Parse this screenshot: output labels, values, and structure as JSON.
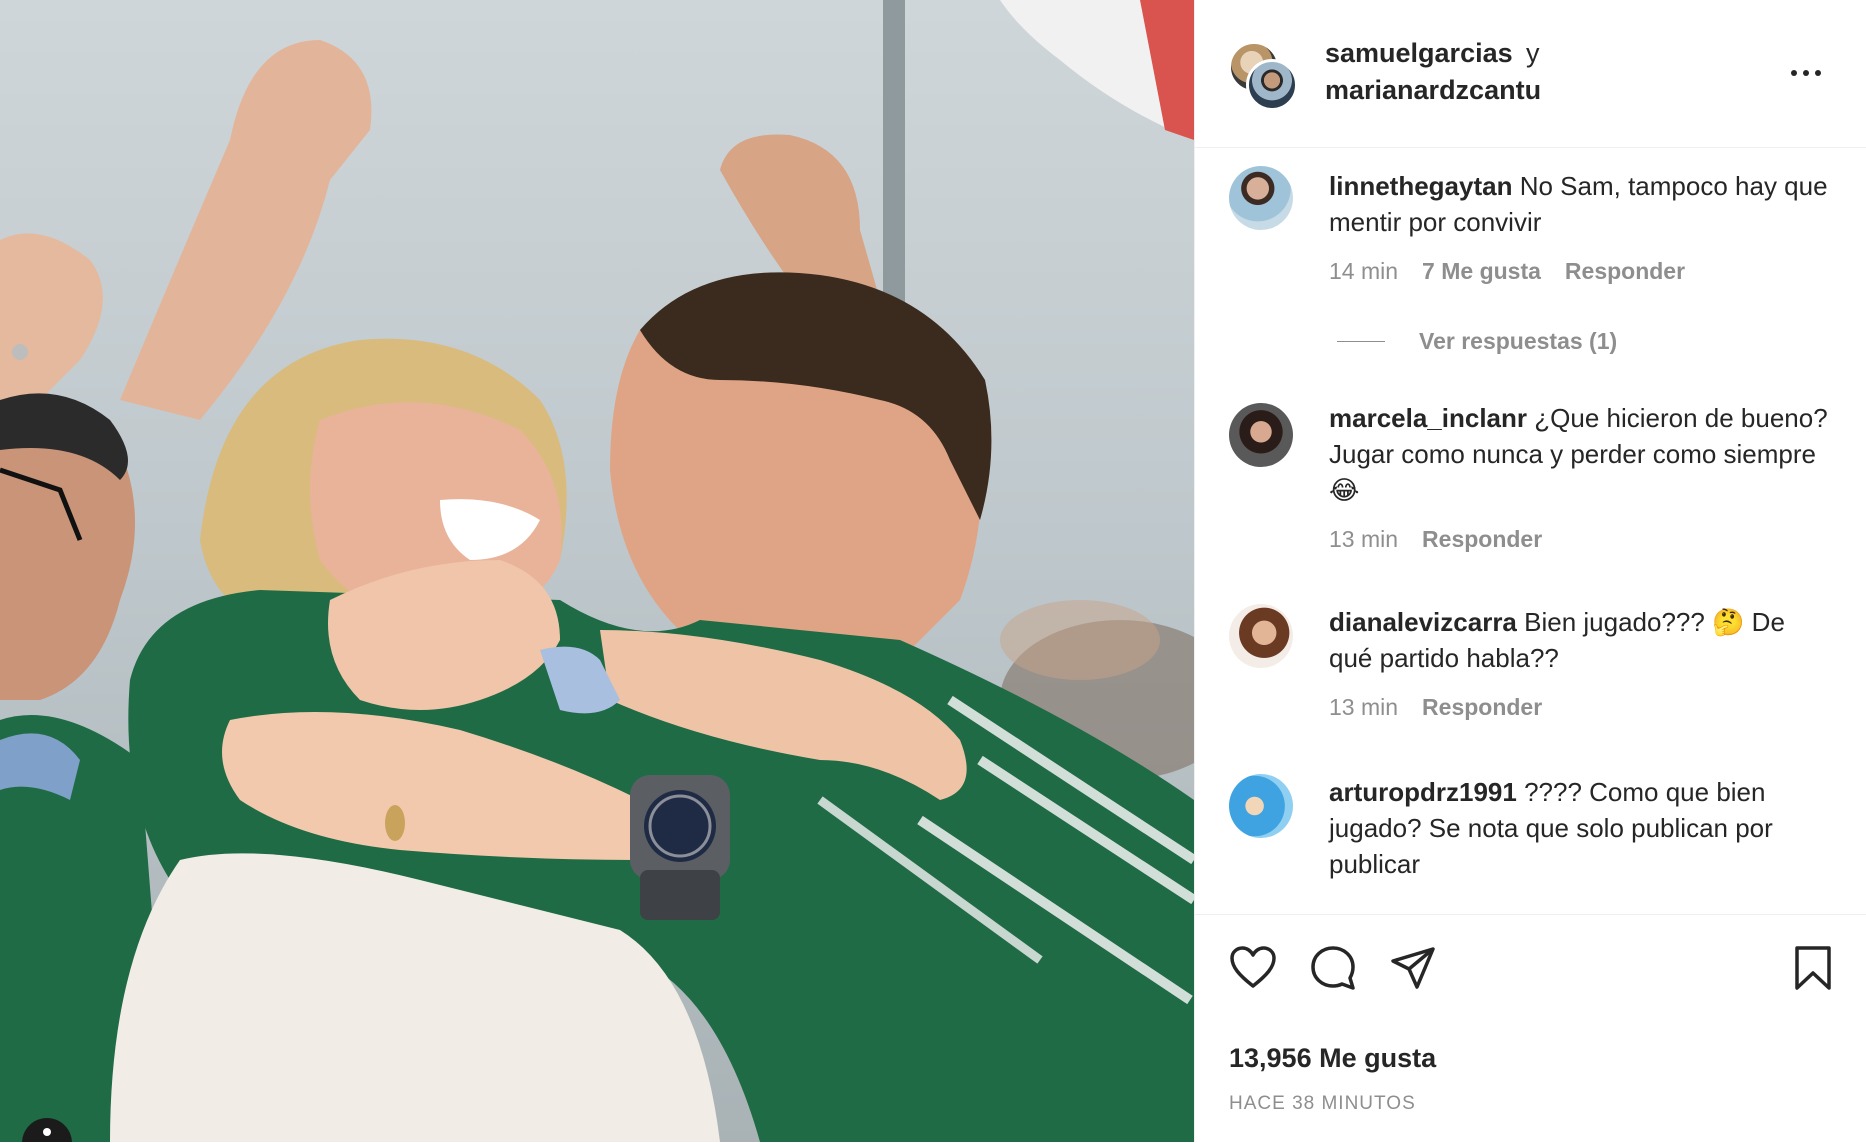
{
  "post": {
    "authors": {
      "first": "samuelgarcias",
      "connector": "y",
      "second": "marianardzcantu"
    },
    "more_icon": "more-options-icon",
    "likes": "13,956 Me gusta",
    "time": "HACE 38 MINUTOS"
  },
  "comments": [
    {
      "user": "linnethegaytan",
      "text": "No Sam, tampoco hay que mentir por convivir",
      "time": "14 min",
      "likes": "7 Me gusta",
      "reply": "Responder",
      "view_replies": "Ver respuestas (1)"
    },
    {
      "user": "marcela_inclanr",
      "text": "¿Que hicieron de bueno? Jugar como nunca y perder como siempre 😂",
      "time": "13 min",
      "reply": "Responder"
    },
    {
      "user": "dianalevizcarra",
      "text": "Bien jugado??? 🤔 De qué partido habla??",
      "time": "13 min",
      "reply": "Responder"
    },
    {
      "user": "arturopdrz1991",
      "text": "???? Como que bien jugado? Se nota que solo publican por publicar"
    }
  ],
  "actions": {
    "like_icon": "heart-icon",
    "comment_icon": "comment-icon",
    "share_icon": "share-icon",
    "save_icon": "bookmark-icon"
  },
  "colors": {
    "text": "#262626",
    "secondary": "#8e8e8e",
    "divider": "#efefef",
    "jersey_green": "#1e6b45"
  }
}
